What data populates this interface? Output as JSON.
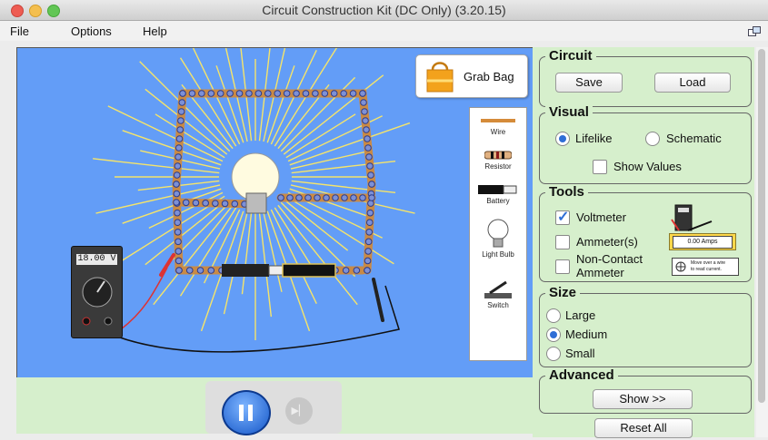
{
  "window": {
    "title": "Circuit Construction Kit (DC Only) (3.20.15)"
  },
  "menu": [
    "File",
    "Options",
    "Help"
  ],
  "canvas": {
    "background": "#639df7",
    "grab_bag_label": "Grab Bag",
    "multimeter_reading": "18.00 V"
  },
  "toolbox": {
    "items": [
      "Wire",
      "Resistor",
      "Battery",
      "Light Bulb",
      "Switch"
    ]
  },
  "controls": {
    "pause_icon": "pause-icon",
    "step_icon": "step-icon"
  },
  "panel": {
    "circuit": {
      "title": "Circuit",
      "save": "Save",
      "load": "Load"
    },
    "visual": {
      "title": "Visual",
      "lifelike": "Lifelike",
      "schematic": "Schematic",
      "selected": "Lifelike",
      "show_values": "Show Values",
      "show_values_checked": false
    },
    "tools": {
      "title": "Tools",
      "voltmeter": "Voltmeter",
      "voltmeter_checked": true,
      "ammeter": "Ammeter(s)",
      "ammeter_checked": false,
      "noncontact_line1": "Non-Contact",
      "noncontact_line2": "Ammeter",
      "noncontact_checked": false,
      "ammeter_reading": "0.00 Amps",
      "noncontact_hint_line1": "Move over a wire",
      "noncontact_hint_line2": "to read current."
    },
    "size": {
      "title": "Size",
      "large": "Large",
      "medium": "Medium",
      "small": "Small",
      "selected": "Medium"
    },
    "advanced": {
      "title": "Advanced",
      "show": "Show >>"
    },
    "reset_all": "Reset All"
  },
  "colors": {
    "accent": "#2f6ed6",
    "panel_bg": "#d6efcc",
    "canvas_bg": "#639df7",
    "wire": "#c98a45",
    "bulb_rays": "#f5e46a"
  }
}
